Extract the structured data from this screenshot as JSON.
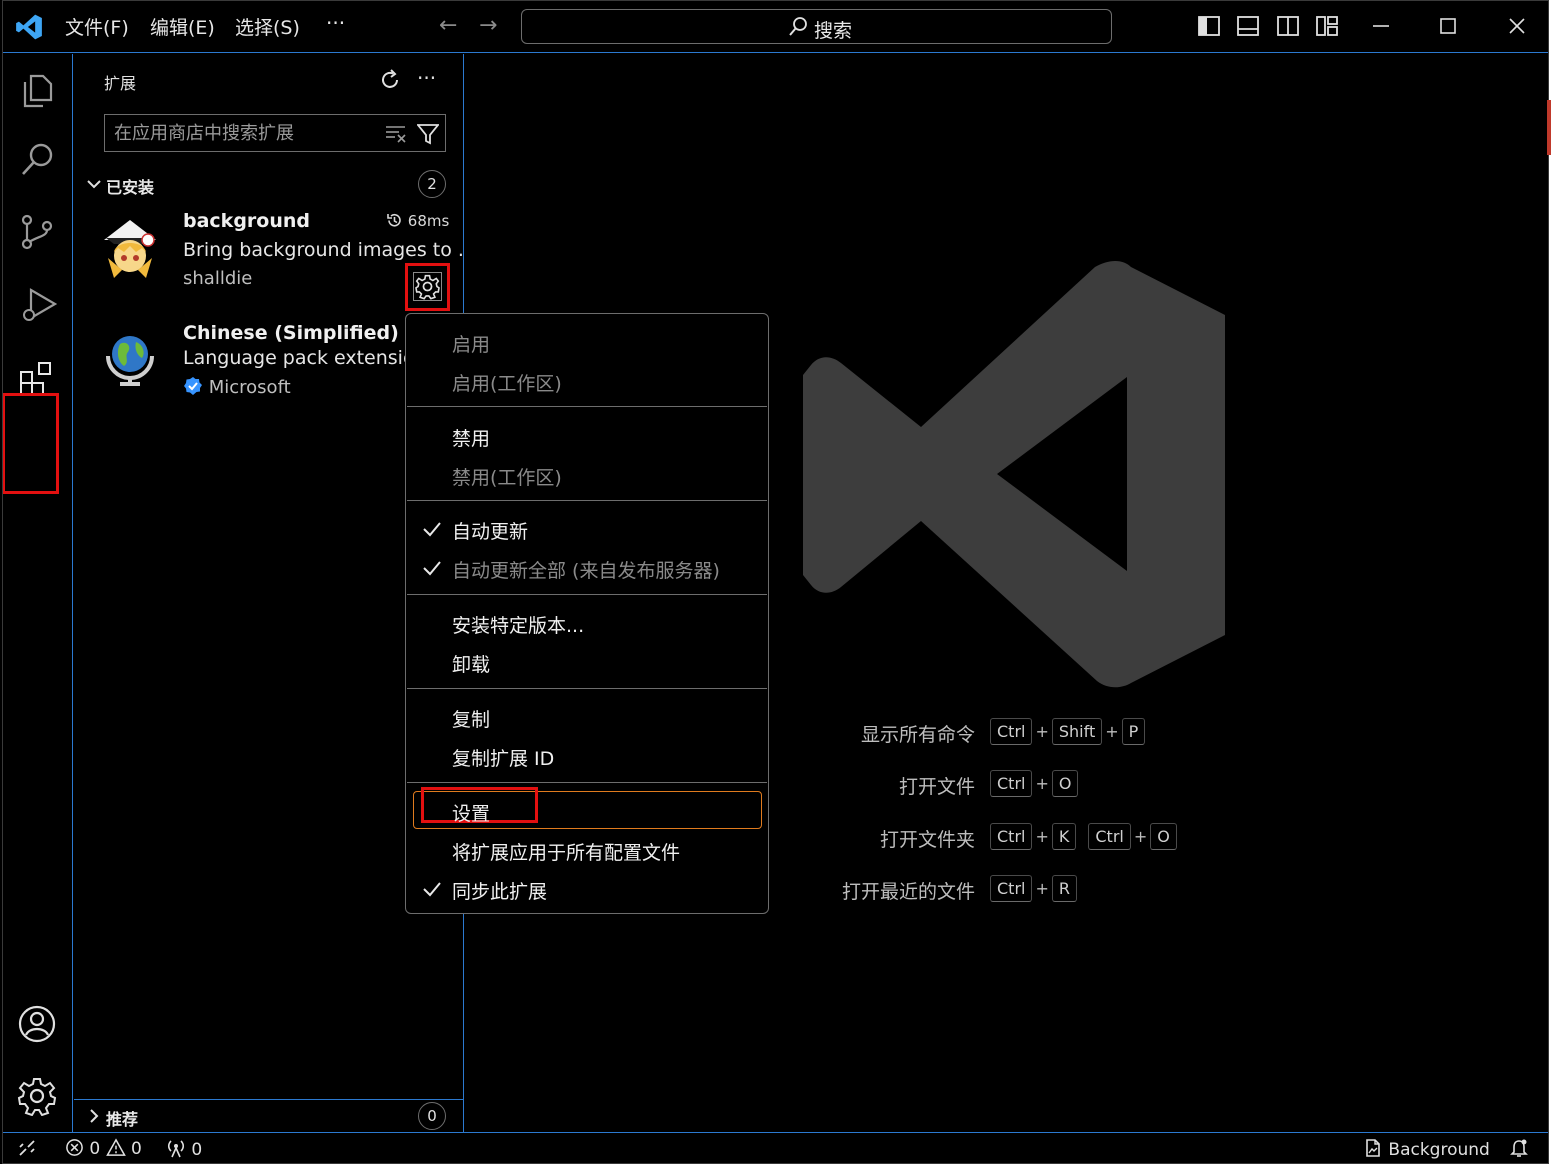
{
  "titlebar": {
    "menus": [
      "文件(F)",
      "编辑(E)",
      "选择(S)",
      "···"
    ],
    "search_label": "搜索",
    "nav_back": "←",
    "nav_forward": "→"
  },
  "sidebar": {
    "title": "扩展",
    "more": "···",
    "search_placeholder": "在应用商店中搜索扩展",
    "installed": {
      "label": "已安装",
      "count": "2"
    },
    "recommended": {
      "label": "推荐",
      "count": "0"
    },
    "extensions": [
      {
        "name": "background",
        "description": "Bring background images to ...",
        "publisher": "shalldie",
        "time": "68ms"
      },
      {
        "name": "Chinese (Simplified) (简体",
        "description": "Language pack extension",
        "publisher": "Microsoft"
      }
    ]
  },
  "context_menu": {
    "groups": [
      [
        {
          "label": "启用",
          "enabled": false
        },
        {
          "label": "启用(工作区)",
          "enabled": false
        }
      ],
      [
        {
          "label": "禁用",
          "enabled": true
        },
        {
          "label": "禁用(工作区)",
          "enabled": false
        }
      ],
      [
        {
          "label": "自动更新",
          "enabled": true,
          "checked": true
        },
        {
          "label": "自动更新全部 (来自发布服务器)",
          "enabled": false,
          "checked": true
        }
      ],
      [
        {
          "label": "安装特定版本...",
          "enabled": true
        },
        {
          "label": "卸载",
          "enabled": true
        }
      ],
      [
        {
          "label": "复制",
          "enabled": true
        },
        {
          "label": "复制扩展 ID",
          "enabled": true
        }
      ],
      [
        {
          "label": "设置",
          "enabled": true,
          "focused": true
        },
        {
          "label": "将扩展应用于所有配置文件",
          "enabled": true
        },
        {
          "label": "同步此扩展",
          "enabled": true,
          "checked": true
        }
      ]
    ]
  },
  "editor": {
    "shortcuts": [
      {
        "label": "显示所有命令",
        "keys": [
          [
            "Ctrl",
            "Shift",
            "P"
          ]
        ]
      },
      {
        "label": "打开文件",
        "keys": [
          [
            "Ctrl",
            "O"
          ]
        ]
      },
      {
        "label": "打开文件夹",
        "keys": [
          [
            "Ctrl",
            "K"
          ],
          [
            "Ctrl",
            "O"
          ]
        ]
      },
      {
        "label": "打开最近的文件",
        "keys": [
          [
            "Ctrl",
            "R"
          ]
        ]
      }
    ],
    "plus": "+"
  },
  "statusbar": {
    "errors": "0",
    "warnings": "0",
    "ports": "0",
    "background_label": "Background"
  },
  "colors": {
    "accent_border": "#2b79d0",
    "highlight_red": "#e31010",
    "focus_orange": "#e07b1e",
    "logo_gray": "#3d3d3d"
  }
}
